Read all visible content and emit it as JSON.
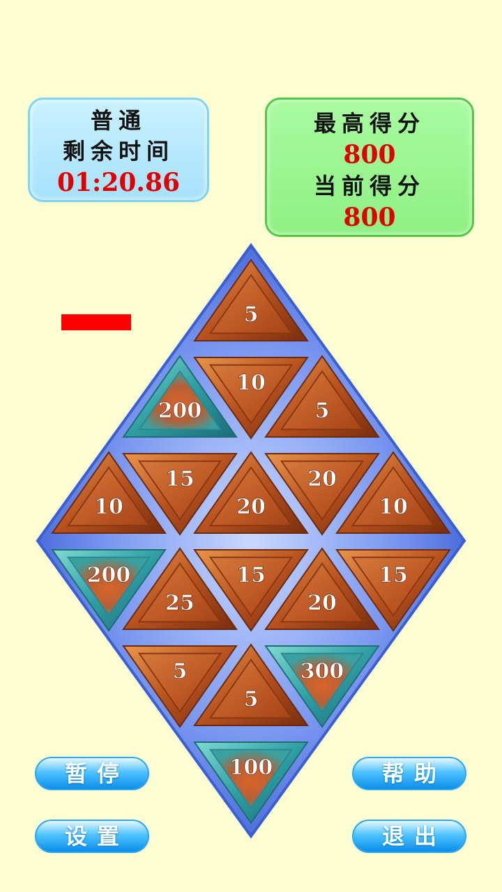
{
  "mode_panel": {
    "mode": "普通",
    "time_label": "剩余时间",
    "time_value": "01:20.86"
  },
  "score_panel": {
    "best_label": "最高得分",
    "best_value": "800",
    "current_label": "当前得分",
    "current_value": "800"
  },
  "board": {
    "tiles": [
      {
        "row": 0,
        "col": 0,
        "dir": "up",
        "value": "5",
        "kind": "wood"
      },
      {
        "row": 1,
        "col": -1,
        "dir": "up",
        "value": "200",
        "kind": "jade"
      },
      {
        "row": 1,
        "col": 0,
        "dir": "down",
        "value": "10",
        "kind": "wood"
      },
      {
        "row": 1,
        "col": 1,
        "dir": "up",
        "value": "5",
        "kind": "wood"
      },
      {
        "row": 2,
        "col": -2,
        "dir": "up",
        "value": "10",
        "kind": "wood"
      },
      {
        "row": 2,
        "col": -1,
        "dir": "down",
        "value": "15",
        "kind": "wood"
      },
      {
        "row": 2,
        "col": 0,
        "dir": "up",
        "value": "20",
        "kind": "wood"
      },
      {
        "row": 2,
        "col": 1,
        "dir": "down",
        "value": "20",
        "kind": "wood"
      },
      {
        "row": 2,
        "col": 2,
        "dir": "up",
        "value": "10",
        "kind": "wood"
      },
      {
        "row": 3,
        "col": -2,
        "dir": "down",
        "value": "200",
        "kind": "jade"
      },
      {
        "row": 3,
        "col": -1,
        "dir": "up",
        "value": "25",
        "kind": "wood"
      },
      {
        "row": 3,
        "col": 0,
        "dir": "down",
        "value": "15",
        "kind": "wood"
      },
      {
        "row": 3,
        "col": 1,
        "dir": "up",
        "value": "20",
        "kind": "wood"
      },
      {
        "row": 3,
        "col": 2,
        "dir": "down",
        "value": "15",
        "kind": "wood"
      },
      {
        "row": 4,
        "col": -1,
        "dir": "down",
        "value": "5",
        "kind": "wood"
      },
      {
        "row": 4,
        "col": 0,
        "dir": "up",
        "value": "5",
        "kind": "wood"
      },
      {
        "row": 4,
        "col": 1,
        "dir": "down",
        "value": "300",
        "kind": "jade"
      },
      {
        "row": 5,
        "col": 0,
        "dir": "down",
        "value": "100",
        "kind": "jade"
      }
    ]
  },
  "buttons": {
    "pause": "暂停",
    "help": "帮助",
    "settings": "设置",
    "exit": "退出"
  },
  "colors": {
    "background": "#fdfdd2",
    "board": "#4a6fe0",
    "score_text": "#e00000",
    "wood": "#c8612a",
    "jade": "#3aa8a8"
  }
}
